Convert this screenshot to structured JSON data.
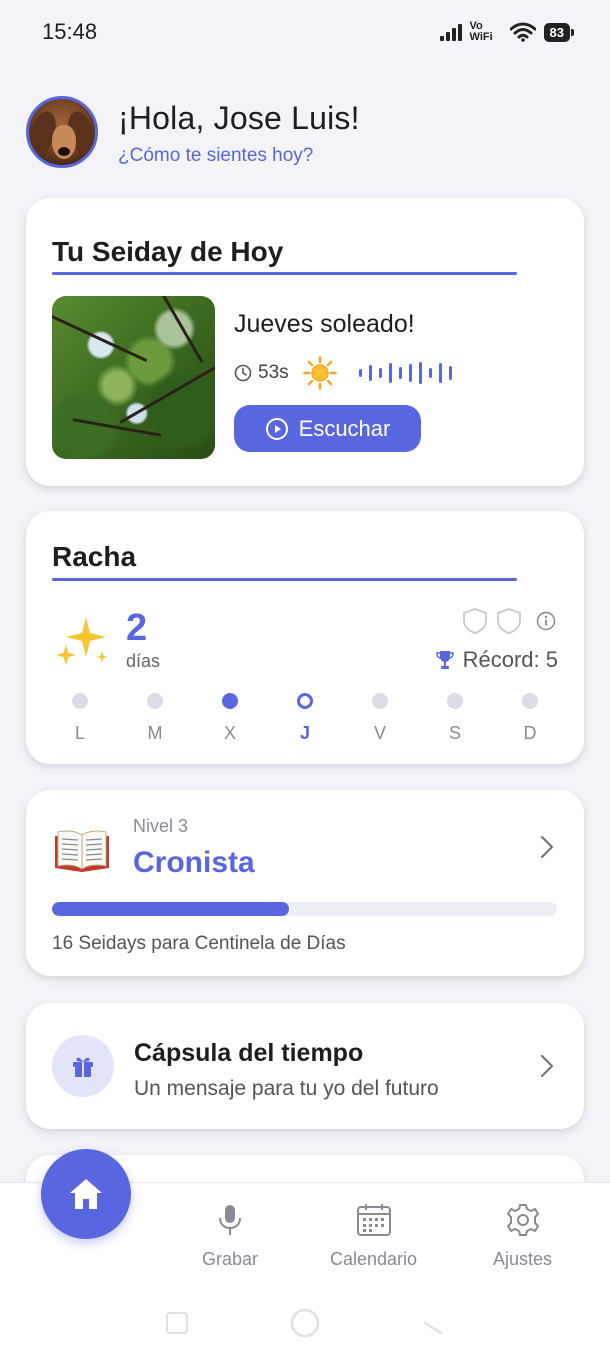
{
  "status_bar": {
    "time": "15:48",
    "network": "Vo WiFi",
    "battery": "83"
  },
  "header": {
    "greeting": "¡Hola, Jose Luis!",
    "subtitle": "¿Cómo te sientes hoy?"
  },
  "seiday": {
    "title": "Tu Seiday de Hoy",
    "entry_title": "Jueves soleado!",
    "duration": "53s",
    "weather_icon": "sun-icon",
    "listen_label": "Escuchar"
  },
  "racha": {
    "title": "Racha",
    "count": "2",
    "unit": "días",
    "record_label": "Récord: 5",
    "days": [
      {
        "label": "L",
        "state": "empty"
      },
      {
        "label": "M",
        "state": "empty"
      },
      {
        "label": "X",
        "state": "filled"
      },
      {
        "label": "J",
        "state": "today"
      },
      {
        "label": "V",
        "state": "empty"
      },
      {
        "label": "S",
        "state": "empty"
      },
      {
        "label": "D",
        "state": "empty"
      }
    ]
  },
  "nivel": {
    "level_label": "Nivel 3",
    "level_name": "Cronista",
    "progress": 0.47,
    "caption": "16 Seidays para Centinela de Días"
  },
  "capsula": {
    "title": "Cápsula del tiempo",
    "subtitle": "Un mensaje para tu yo del futuro"
  },
  "nav": {
    "items": [
      {
        "label": "Grabar",
        "icon": "mic-icon"
      },
      {
        "label": "Calendario",
        "icon": "calendar-icon"
      },
      {
        "label": "Ajustes",
        "icon": "gear-icon"
      }
    ],
    "home_icon": "home-icon"
  },
  "colors": {
    "accent": "#5a66e0",
    "background": "#f4f4f8",
    "card": "#ffffff"
  }
}
